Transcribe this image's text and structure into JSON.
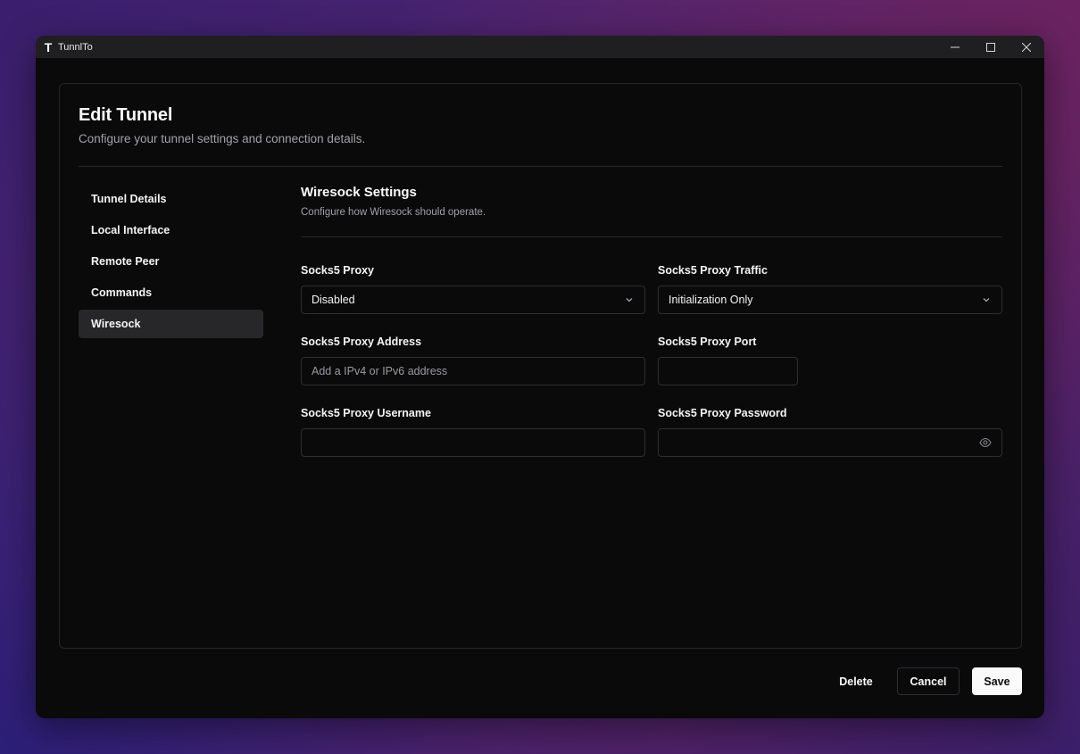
{
  "app": {
    "title": "TunnlTo"
  },
  "page": {
    "title": "Edit Tunnel",
    "subtitle": "Configure your tunnel settings and connection details."
  },
  "sidebar": {
    "items": [
      {
        "label": "Tunnel Details"
      },
      {
        "label": "Local Interface"
      },
      {
        "label": "Remote Peer"
      },
      {
        "label": "Commands"
      },
      {
        "label": "Wiresock",
        "active": true
      }
    ]
  },
  "section": {
    "title": "Wiresock Settings",
    "subtitle": "Configure how Wiresock should operate."
  },
  "fields": {
    "proxy": {
      "label": "Socks5 Proxy",
      "value": "Disabled"
    },
    "traffic": {
      "label": "Socks5 Proxy Traffic",
      "value": "Initialization Only"
    },
    "address": {
      "label": "Socks5 Proxy Address",
      "value": "",
      "placeholder": "Add a IPv4 or IPv6 address"
    },
    "port": {
      "label": "Socks5 Proxy Port",
      "value": ""
    },
    "username": {
      "label": "Socks5 Proxy Username",
      "value": ""
    },
    "password": {
      "label": "Socks5 Proxy Password",
      "value": ""
    }
  },
  "footer": {
    "delete_label": "Delete",
    "cancel_label": "Cancel",
    "save_label": "Save"
  },
  "icons": {
    "app": "app-logo-icon",
    "minimize": "minimize-icon",
    "maximize": "maximize-icon",
    "close": "close-icon",
    "chevron": "chevron-down-icon",
    "eye": "eye-icon"
  },
  "colors": {
    "window_bg": "#0a0a0b",
    "titlebar_bg": "#1f1f21",
    "active_item_bg": "#27272a",
    "save_bg": "#fafafa"
  }
}
